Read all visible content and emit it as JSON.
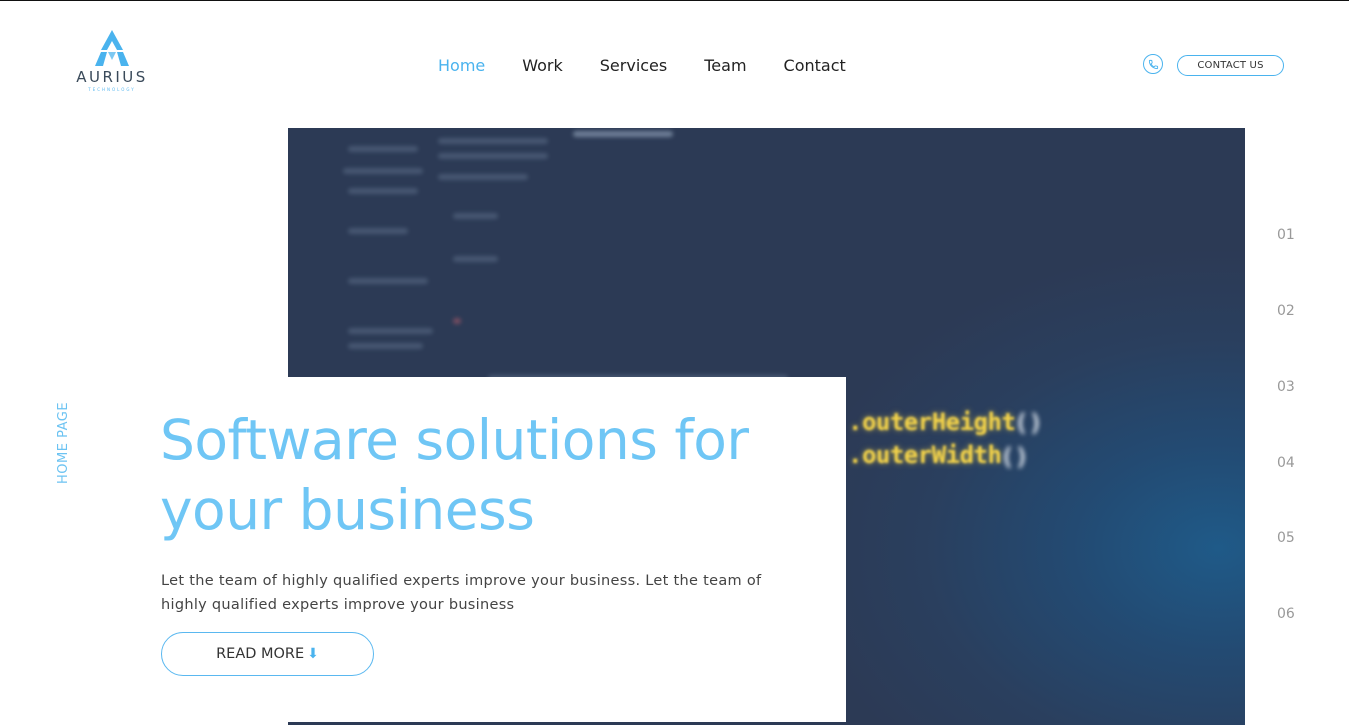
{
  "brand": {
    "name": "AURIUS",
    "tagline": "TECHNOLOGY",
    "accent_color": "#4ab3ee"
  },
  "nav": {
    "items": [
      {
        "label": "Home",
        "active": true
      },
      {
        "label": "Work",
        "active": false
      },
      {
        "label": "Services",
        "active": false
      },
      {
        "label": "Team",
        "active": false
      },
      {
        "label": "Contact",
        "active": false
      }
    ]
  },
  "header": {
    "phone_icon": "phone-icon",
    "contact_label": "CONTACT US"
  },
  "side_label": "HOME PAGE",
  "hero": {
    "title": "Software solutions for your business",
    "description": "Let the team of highly qualified experts improve your business. Let the team of highly qualified experts improve your business",
    "button_label": "READ MORE",
    "button_icon": "arrow-down-icon",
    "image_code": {
      "line1": ".outerHeight",
      "line2": ".outerWidth",
      "parens": "()"
    }
  },
  "slides": [
    "01",
    "02",
    "03",
    "04",
    "05",
    "06"
  ]
}
